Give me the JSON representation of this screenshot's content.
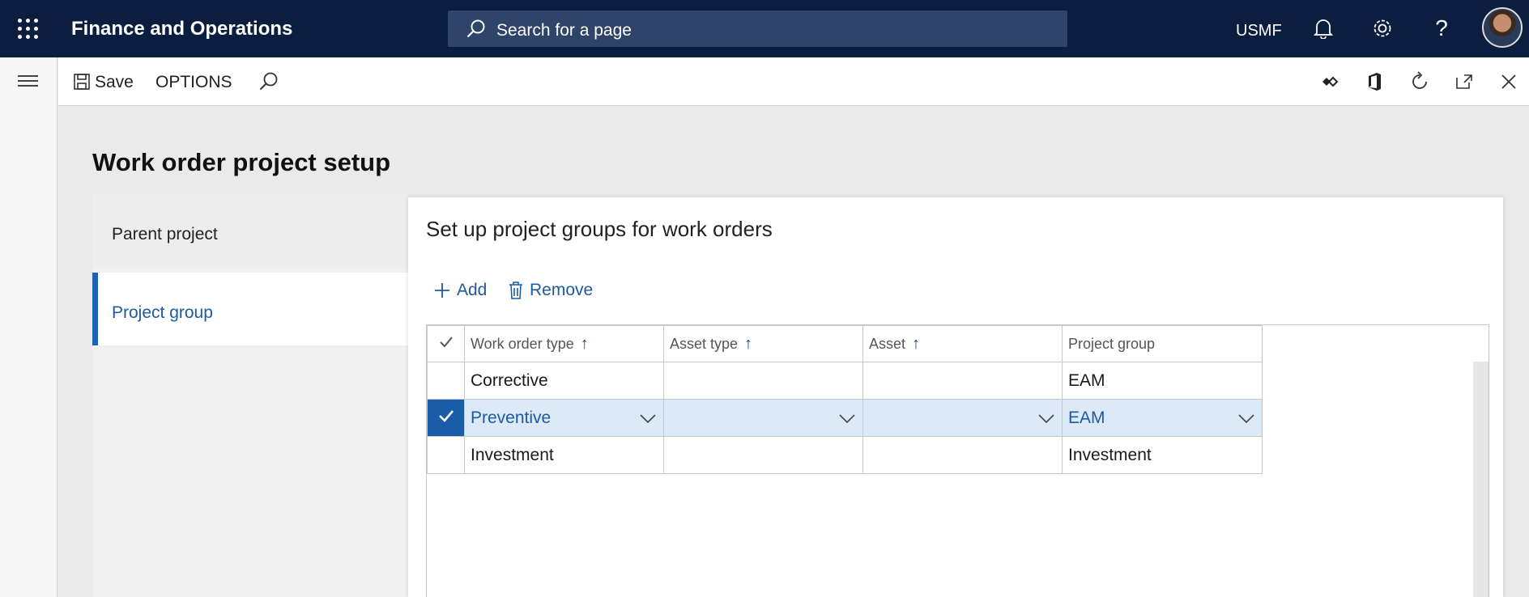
{
  "topbar": {
    "app_title": "Finance and Operations",
    "search_placeholder": "Search for a page",
    "company": "USMF"
  },
  "actionpane": {
    "save_label": "Save",
    "options_label": "OPTIONS"
  },
  "page": {
    "title": "Work order project setup"
  },
  "tabs": [
    {
      "label": "Parent project",
      "selected": false
    },
    {
      "label": "Project group",
      "selected": true
    }
  ],
  "panel": {
    "title": "Set up project groups for work orders",
    "add_label": "Add",
    "remove_label": "Remove"
  },
  "grid": {
    "columns": [
      "Work order type",
      "Asset type",
      "Asset",
      "Project group"
    ],
    "rows": [
      {
        "work_order_type": "Corrective",
        "asset_type": "",
        "asset": "",
        "project_group": "EAM",
        "selected": false
      },
      {
        "work_order_type": "Preventive",
        "asset_type": "",
        "asset": "",
        "project_group": "EAM",
        "selected": true
      },
      {
        "work_order_type": "Investment",
        "asset_type": "",
        "asset": "",
        "project_group": "Investment",
        "selected": false
      }
    ]
  },
  "colors": {
    "nav_bg": "#0b1e3f",
    "accent": "#1e5aa0",
    "selected_row": "#dce9f7"
  }
}
